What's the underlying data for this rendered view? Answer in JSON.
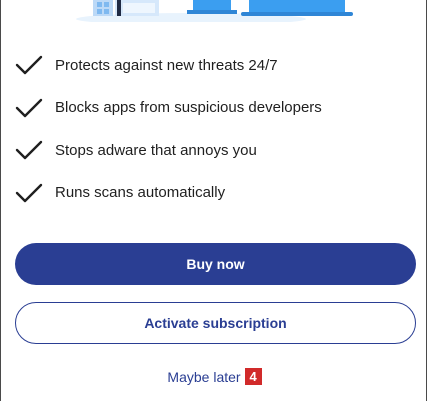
{
  "features": [
    {
      "text": "Protects against new threats 24/7"
    },
    {
      "text": "Blocks apps from suspicious developers"
    },
    {
      "text": "Stops adware that annoys you"
    },
    {
      "text": "Runs scans automatically"
    }
  ],
  "actions": {
    "buy_label": "Buy now",
    "activate_label": "Activate subscription",
    "maybe_later_label": "Maybe later",
    "marker": "4"
  },
  "colors": {
    "accent": "#2a3e93",
    "badge": "#d12a2a",
    "illustration": "#3b9ef0"
  }
}
